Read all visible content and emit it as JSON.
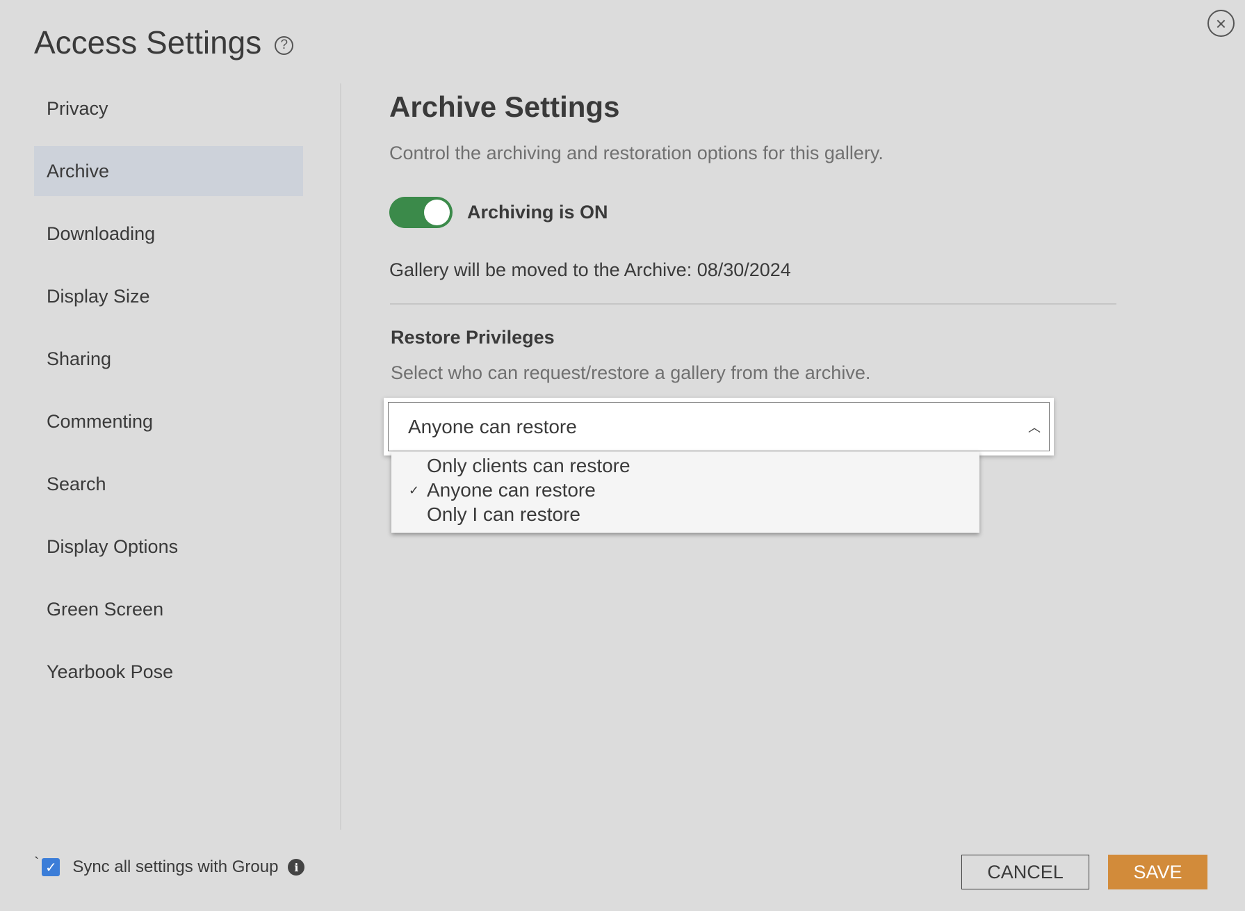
{
  "modal": {
    "title": "Access Settings",
    "help_icon": "question-circle-icon",
    "close_icon": "close-circle-icon"
  },
  "sidebar": {
    "items": [
      {
        "label": "Privacy",
        "active": false
      },
      {
        "label": "Archive",
        "active": true
      },
      {
        "label": "Downloading",
        "active": false
      },
      {
        "label": "Display Size",
        "active": false
      },
      {
        "label": "Sharing",
        "active": false
      },
      {
        "label": "Commenting",
        "active": false
      },
      {
        "label": "Search",
        "active": false
      },
      {
        "label": "Display Options",
        "active": false
      },
      {
        "label": "Green Screen",
        "active": false
      },
      {
        "label": "Yearbook Pose",
        "active": false
      }
    ]
  },
  "archive": {
    "title": "Archive Settings",
    "description": "Control the archiving and restoration options for this gallery.",
    "toggle_label": "Archiving is ON",
    "toggle_on": true,
    "archive_date_text": "Gallery will be moved to the Archive: 08/30/2024",
    "restore": {
      "title": "Restore Privileges",
      "description": "Select who can request/restore a gallery from the archive.",
      "selected": "Anyone can restore",
      "options": [
        {
          "label": "Only clients can restore",
          "checked": false
        },
        {
          "label": "Anyone can restore",
          "checked": true
        },
        {
          "label": "Only I can restore",
          "checked": false
        }
      ]
    }
  },
  "footer": {
    "tick": "`",
    "sync_label": "Sync all settings with Group",
    "sync_checked": true,
    "info_icon": "info-icon",
    "cancel_label": "CANCEL",
    "save_label": "SAVE"
  },
  "colors": {
    "background": "#dcdcdc",
    "active_item": "#cdd2da",
    "toggle_on": "#3b8a4a",
    "checkbox": "#3b7dd8",
    "save_button": "#d28b3a"
  }
}
